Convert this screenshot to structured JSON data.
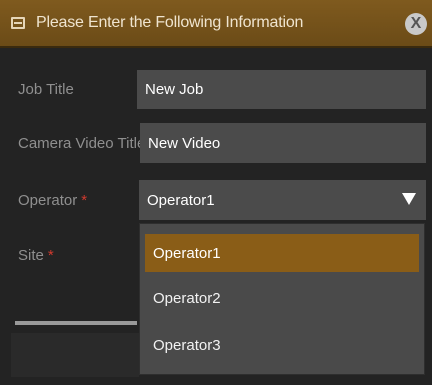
{
  "dialog": {
    "title": "Please Enter the Following Information",
    "close_glyph": "X",
    "icon": "window-icon"
  },
  "form": {
    "job_title": {
      "label": "Job Title",
      "value": "New Job"
    },
    "camera_video_title": {
      "label": "Camera Video Title",
      "value": "New Video"
    },
    "operator": {
      "label": "Operator",
      "required_mark": "*",
      "selected": "Operator1"
    },
    "site": {
      "label": "Site",
      "required_mark": "*"
    }
  },
  "operator_menu": {
    "options": [
      "Operator1",
      "Operator2",
      "Operator3"
    ],
    "highlighted": "Operator1"
  },
  "colors": {
    "titlebar": "#7f5a1e",
    "highlight": "#8a5d17",
    "required": "#d23a2e",
    "field_bg": "#4b4b4b"
  }
}
